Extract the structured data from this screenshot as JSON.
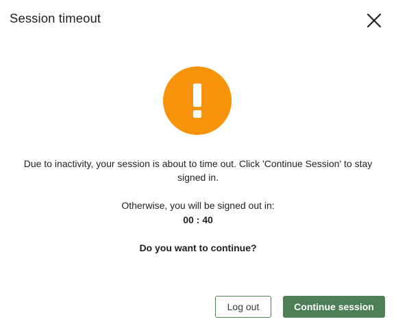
{
  "dialog": {
    "title": "Session timeout",
    "close_icon": "close-icon",
    "alert_icon": "exclamation-icon",
    "alert_color": "#f7930b",
    "message": "Due to inactivity, your session is about to time out. Click 'Continue Session' to stay signed in.",
    "otherwise_text": "Otherwise, you will be signed out in:",
    "countdown": "00 : 40",
    "question": "Do you want to continue?",
    "logout_label": "Log out",
    "continue_label": "Continue session",
    "accent_color": "#4d7f57"
  }
}
